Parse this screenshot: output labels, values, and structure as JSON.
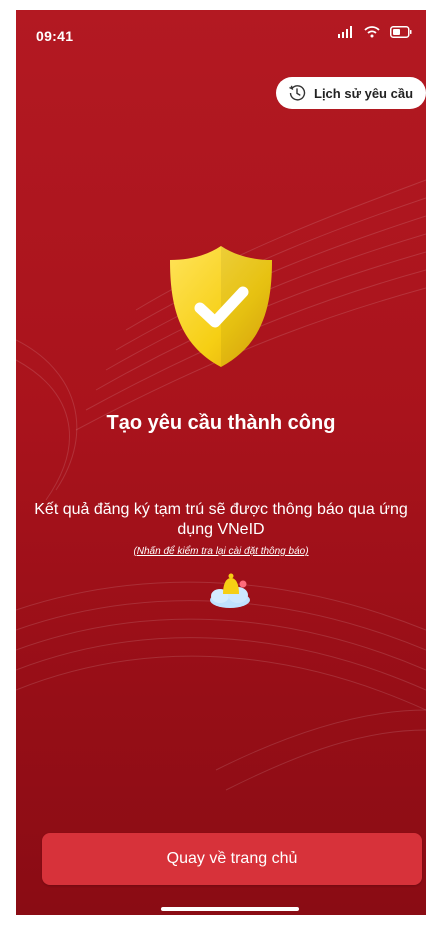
{
  "status_bar": {
    "time": "09:41"
  },
  "header": {
    "history_label": "Lịch sử yêu cầu"
  },
  "main": {
    "title": "Tạo yêu cầu thành công",
    "message": "Kết quả đăng ký tạm trú sẽ được thông báo qua ứng dụng VNeID",
    "hint": "(Nhấn để kiểm tra lại cài đặt thông báo)"
  },
  "footer": {
    "home_button_label": "Quay về trang chủ"
  },
  "colors": {
    "background": "#a9131c",
    "button": "#d7323a",
    "shield": "#f7d219"
  },
  "icons": [
    "signal-icon",
    "wifi-icon",
    "battery-icon",
    "clock-history-icon",
    "shield-check-icon",
    "bell-cloud-icon"
  ]
}
